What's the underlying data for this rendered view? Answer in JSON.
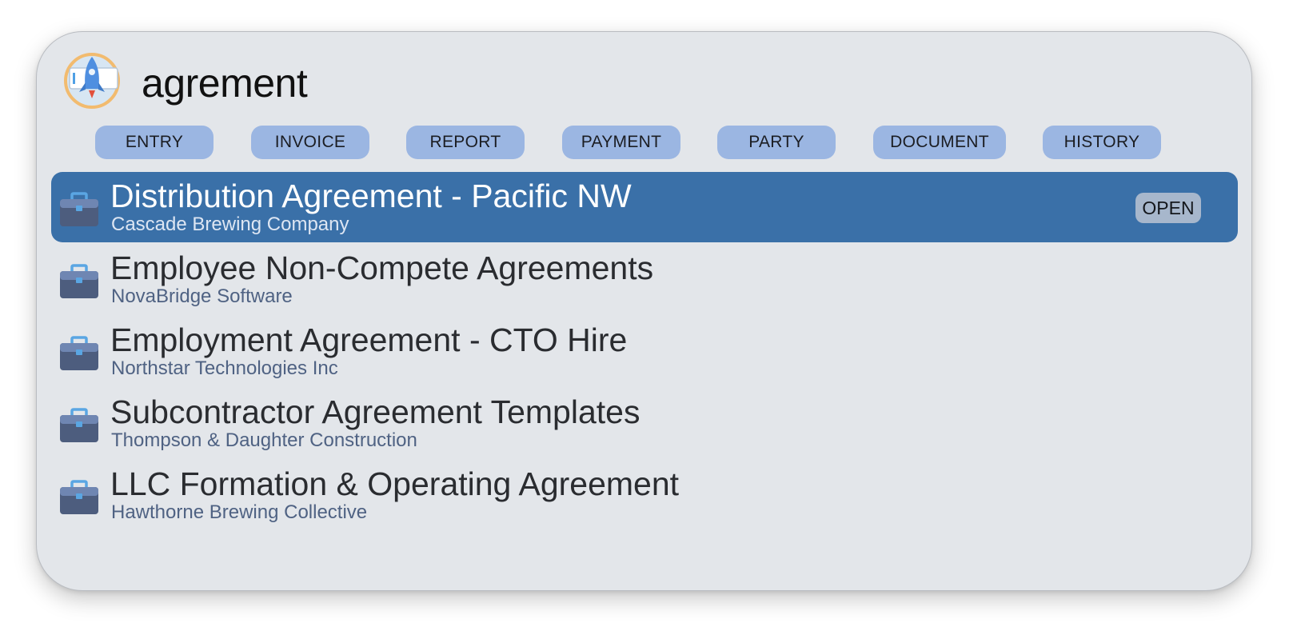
{
  "search": {
    "query": "agrement"
  },
  "app_icon": "rocket-launcher-icon",
  "categories": [
    {
      "label": "ENTRY"
    },
    {
      "label": "INVOICE"
    },
    {
      "label": "REPORT"
    },
    {
      "label": "PAYMENT"
    },
    {
      "label": "PARTY"
    },
    {
      "label": "DOCUMENT"
    },
    {
      "label": "HISTORY"
    }
  ],
  "results": [
    {
      "title": "Distribution Agreement - Pacific NW",
      "subtitle": "Cascade Brewing Company",
      "selected": true,
      "action_label": "OPEN",
      "icon": "briefcase-icon"
    },
    {
      "title": "Employee Non-Compete Agreements",
      "subtitle": "NovaBridge Software",
      "selected": false,
      "icon": "briefcase-icon"
    },
    {
      "title": "Employment Agreement - CTO Hire",
      "subtitle": "Northstar Technologies Inc",
      "selected": false,
      "icon": "briefcase-icon"
    },
    {
      "title": "Subcontractor Agreement Templates",
      "subtitle": "Thompson & Daughter Construction",
      "selected": false,
      "icon": "briefcase-icon"
    },
    {
      "title": "LLC Formation & Operating Agreement",
      "subtitle": "Hawthorne Brewing Collective",
      "selected": false,
      "icon": "briefcase-icon"
    }
  ],
  "colors": {
    "panel_background": "#e3e6ea",
    "chip_background": "#9bb6e2",
    "selected_row": "#3a70a8",
    "subtitle_text": "#4f6283",
    "icon_body": "#4d5d7e",
    "icon_handle": "#5aa6e3"
  }
}
